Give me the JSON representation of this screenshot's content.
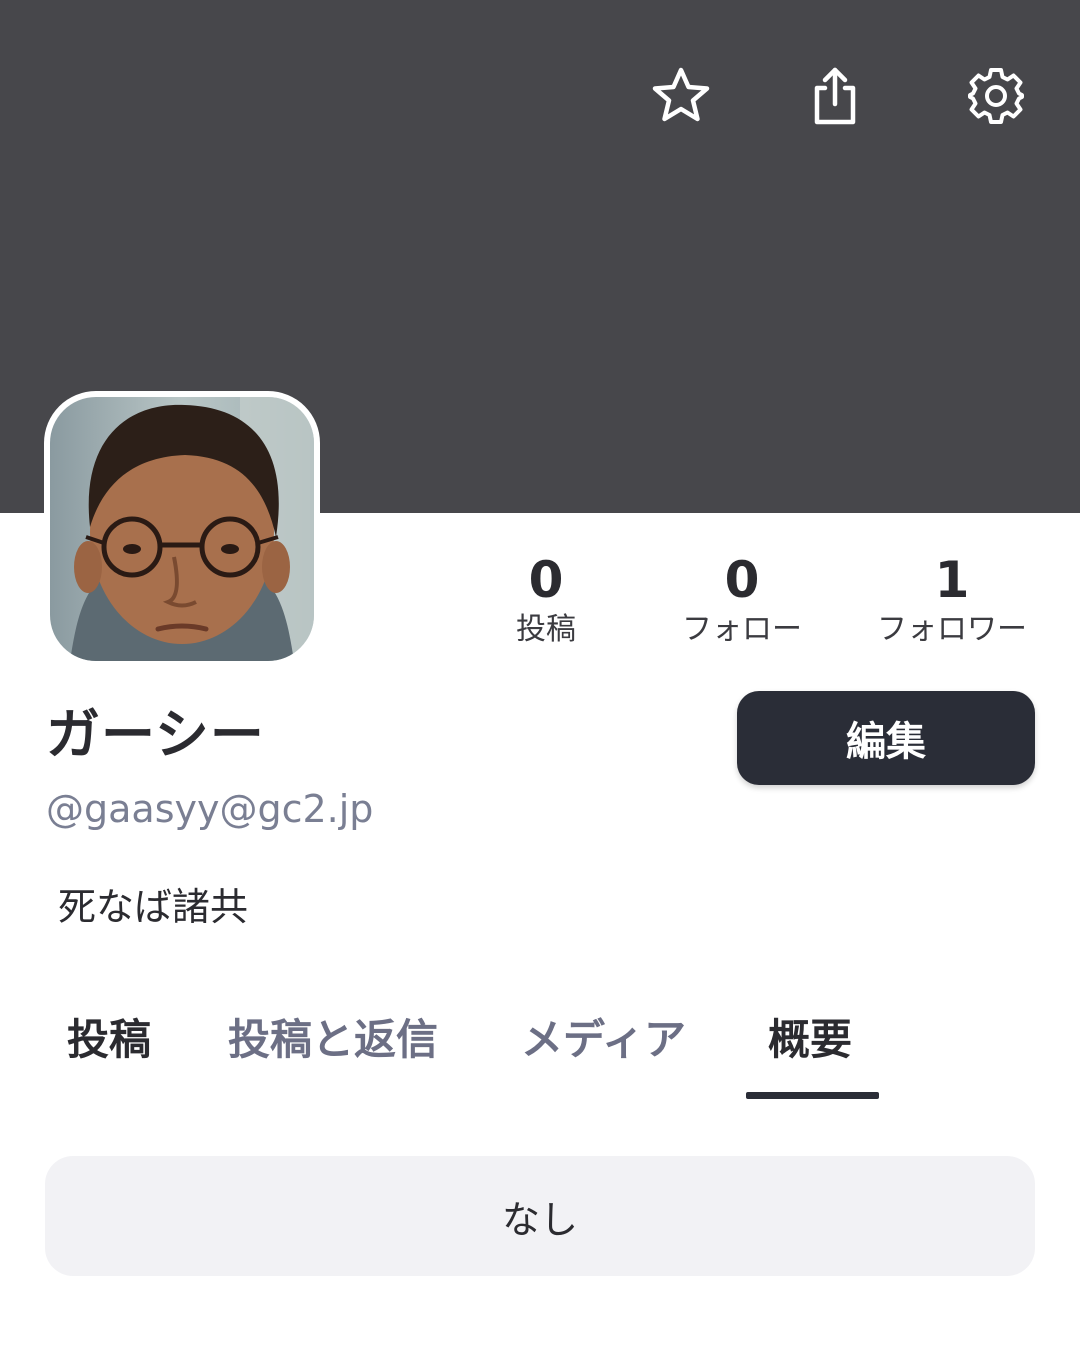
{
  "header": {
    "actions": [
      {
        "icon": "star-icon",
        "label": "favorite"
      },
      {
        "icon": "share-icon",
        "label": "share"
      },
      {
        "icon": "gear-icon",
        "label": "settings"
      }
    ],
    "banner_color": "#47474b"
  },
  "profile": {
    "display_name": "ガーシー",
    "handle": "@gaasyy@gc2.jp",
    "bio": "死なば諸共",
    "edit_label": "編集"
  },
  "stats": {
    "posts": {
      "value": "0",
      "label": "投稿"
    },
    "following": {
      "value": "0",
      "label": "フォロー"
    },
    "followers": {
      "value": "1",
      "label": "フォロワー"
    }
  },
  "tabs": [
    {
      "label": "投稿"
    },
    {
      "label": "投稿と返信"
    },
    {
      "label": "メディア"
    },
    {
      "label": "概要",
      "selected": true
    }
  ],
  "about": {
    "text": "なし"
  },
  "colors": {
    "accent_dark": "#2a2d37",
    "muted_text": "#7a7f93",
    "box_bg": "#f2f2f5"
  }
}
